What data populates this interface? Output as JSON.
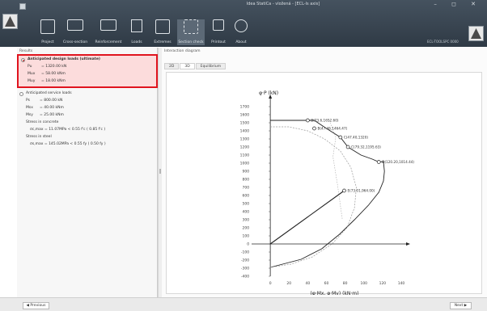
{
  "window": {
    "title": "Idea StatiCa - vložená - [ECL-ls axis]",
    "controls": "– ◻ ✕"
  },
  "ribbon": {
    "items": [
      {
        "label": "Project",
        "icon": "project-icon"
      },
      {
        "label": "Cross-section",
        "icon": "cross-section-icon"
      },
      {
        "label": "Reinforcement",
        "icon": "reinforcement-icon"
      },
      {
        "label": "Loads",
        "icon": "loads-icon"
      },
      {
        "label": "Extremes",
        "icon": "extremes-icon"
      },
      {
        "label": "Section check",
        "icon": "section-check-icon"
      },
      {
        "label": "Printout",
        "icon": "printout-icon"
      },
      {
        "label": "About",
        "icon": "about-icon"
      }
    ],
    "version": "ECL-TOOLSPC 0000"
  },
  "results": {
    "panel_title": "Results",
    "ultimate": {
      "title": "Anticipated design loads (ultimate)",
      "lines": [
        {
          "name": "Pu",
          "value": "= 1320.00  kN"
        },
        {
          "name": "Mux",
          "value": "=  58.00  kNm"
        },
        {
          "name": "Muy",
          "value": "=  18.00  kNm"
        }
      ]
    },
    "service": {
      "title": "Anticipated service loads",
      "lines": [
        {
          "name": "Ps",
          "value": "= 800.00  kN"
        },
        {
          "name": "Msx",
          "value": "=  40.00  kNm"
        },
        {
          "name": "Msy",
          "value": "=  25.00  kNm"
        }
      ],
      "concrete_title": "Stress in concrete",
      "concrete_value": "σc,max = 11.07MPa < 0.55 f'c ( 0.85 f'c )",
      "steel_title": "Stress in steel",
      "steel_value": "σs,max = 145.02MPa < 0.55 fy ( 0.50 fy )"
    }
  },
  "diagram": {
    "title": "Interaction diagram",
    "tabs": [
      "2D",
      "3D",
      "Equilibrium"
    ],
    "toolbar": [
      "⊞",
      "⊕",
      "⊖",
      "⤢",
      "⟲",
      "⎙"
    ]
  },
  "chart_data": {
    "type": "line",
    "ylabel": "φ·P (kN)",
    "xlabel": "(φ·Mx, φ·My) (kN·m)",
    "xlim": [
      -20,
      140
    ],
    "ylim": [
      -400,
      1800
    ],
    "xticks": [
      0,
      20,
      40,
      60,
      80,
      100,
      120,
      140
    ],
    "yticks": [
      -400,
      -300,
      -200,
      -100,
      0,
      100,
      200,
      300,
      400,
      500,
      600,
      700,
      800,
      900,
      1000,
      1100,
      1200,
      1300,
      1400,
      1500,
      1600,
      1700
    ],
    "series": [
      {
        "x": [
          0,
          40,
          47,
          60,
          75,
          83,
          97,
          109,
          116,
          121,
          122,
          121,
          116,
          105,
          90,
          74,
          55,
          33,
          0
        ],
        "y": [
          1530,
          1530,
          1530,
          1430,
          1320,
          1200,
          1100,
          1050,
          1015,
          1020,
          900,
          780,
          640,
          480,
          300,
          120,
          -60,
          -190,
          -290
        ]
      },
      {
        "x": [
          0,
          20,
          40,
          58,
          75,
          86,
          92,
          90,
          82,
          66,
          45,
          22,
          0
        ],
        "y": [
          1450,
          1450,
          1400,
          1300,
          1150,
          950,
          700,
          450,
          200,
          0,
          -160,
          -250,
          -290
        ]
      },
      {
        "x": [
          63,
          70,
          67,
          72,
          77
        ],
        "y": [
          1530,
          1320,
          1080,
          720,
          300
        ]
      },
      {
        "x": [
          0,
          79
        ],
        "y": [
          0,
          660
        ]
      }
    ],
    "points": [
      {
        "label": "B(73.6,1652.60)",
        "x": 40,
        "y": 1530
      },
      {
        "label": "B(47.46,1464.47)",
        "x": 47,
        "y": 1430
      },
      {
        "label": "C(47.40,1320)",
        "x": 75,
        "y": 1320
      },
      {
        "label": "C(79.32,1195.63)",
        "x": 83,
        "y": 1200
      },
      {
        "label": "D(120.20,1014.44)",
        "x": 116,
        "y": 1015
      },
      {
        "label": "E(73.01,964.00)",
        "x": 79,
        "y": 660
      }
    ]
  },
  "footer": {
    "prev_label": "◀ Previous",
    "next_label": "Next ▶"
  }
}
